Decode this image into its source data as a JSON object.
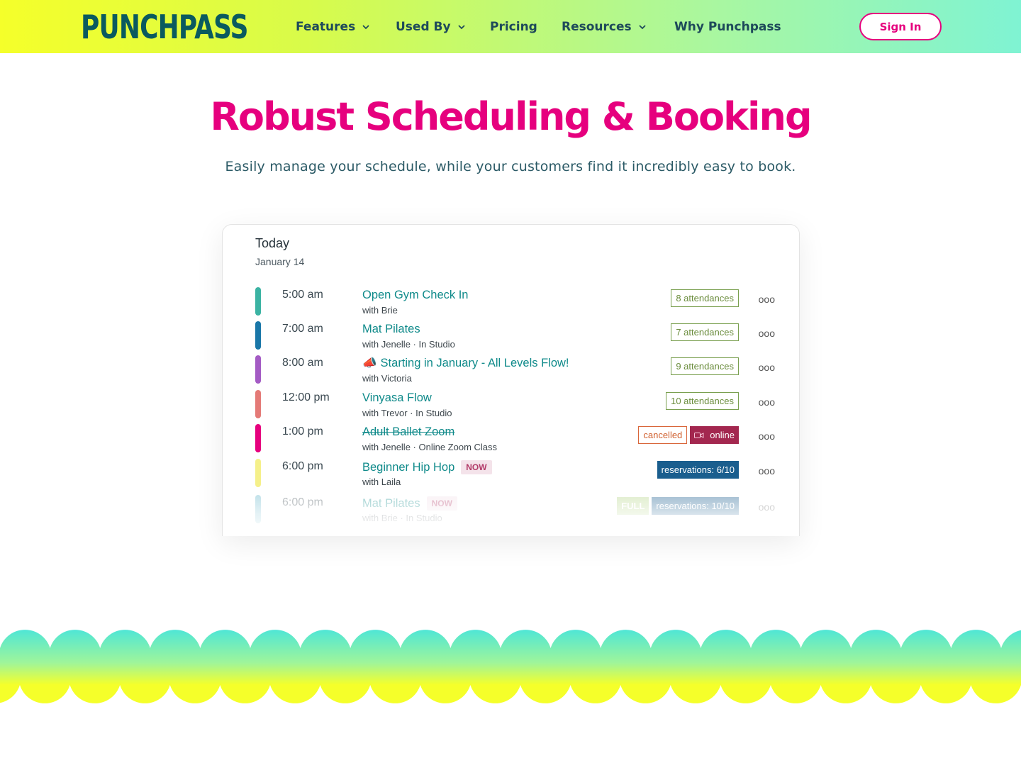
{
  "header": {
    "logo_text": "PUNCHPASS",
    "nav": [
      {
        "label": "Features",
        "dropdown": true
      },
      {
        "label": "Used By",
        "dropdown": true
      },
      {
        "label": "Pricing",
        "dropdown": false
      },
      {
        "label": "Resources",
        "dropdown": true
      },
      {
        "label": "Why Punchpass",
        "dropdown": false
      }
    ],
    "sign_in": "Sign In"
  },
  "hero": {
    "title": "Robust Scheduling & Booking",
    "subtitle": "Easily manage your schedule, while your customers find it incredibly easy to book."
  },
  "schedule": {
    "title": "Today",
    "date": "January 14",
    "rows": [
      {
        "time": "5:00 am",
        "name": "Open Gym Check In",
        "with": "with Brie",
        "color": "#3bb3a3",
        "badges": [
          {
            "type": "att",
            "text": "8 attendances"
          }
        ]
      },
      {
        "time": "7:00 am",
        "name": "Mat Pilates",
        "with": "with Jenelle · In Studio",
        "color": "#1a77a8",
        "badges": [
          {
            "type": "att",
            "text": "7 attendances"
          }
        ]
      },
      {
        "time": "8:00 am",
        "name": "Starting in January - All Levels Flow!",
        "prefix": "📣",
        "with": "with Victoria",
        "color": "#a45bc4",
        "badges": [
          {
            "type": "att",
            "text": "9 attendances"
          }
        ]
      },
      {
        "time": "12:00 pm",
        "name": "Vinyasa Flow",
        "with": "with Trevor · In Studio",
        "color": "#e47a77",
        "badges": [
          {
            "type": "att",
            "text": "10 attendances"
          }
        ]
      },
      {
        "time": "1:00 pm",
        "name": "Adult Ballet Zoom",
        "cancelled": true,
        "with": "with Jenelle · Online Zoom Class",
        "color": "#e6007e",
        "badges": [
          {
            "type": "cancel",
            "text": "cancelled"
          },
          {
            "type": "online",
            "text": "online"
          }
        ]
      },
      {
        "time": "6:00 pm",
        "name": "Beginner Hip Hop",
        "now": "NOW",
        "with": "with Laila",
        "color": "#f5f08a",
        "badges": [
          {
            "type": "res",
            "text": "reservations: 6/10"
          }
        ]
      },
      {
        "time": "6:00 pm",
        "name": "Mat Pilates",
        "now": "NOW",
        "with": "with Brie · In Studio",
        "color": "#6ab7cc",
        "faded": true,
        "badges": [
          {
            "type": "full",
            "text": "FULL"
          },
          {
            "type": "res",
            "text": "reservations: 10/10"
          }
        ]
      }
    ],
    "more_glyph": "ooo"
  },
  "colors": {
    "brand_pink": "#e6007e",
    "brand_teal": "#0a5a5f",
    "header_gradient_start": "#f5ff2a",
    "header_gradient_end": "#7ff3d3"
  }
}
